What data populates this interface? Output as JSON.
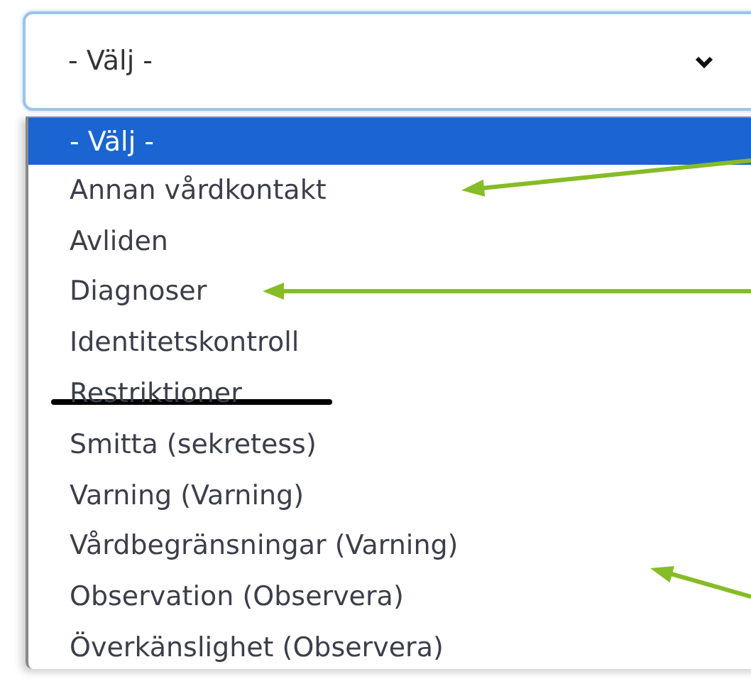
{
  "select": {
    "value": "- Välj -",
    "expanded": true
  },
  "options": [
    {
      "label": "- Välj -",
      "selected": true
    },
    {
      "label": "Annan vårdkontakt",
      "selected": false
    },
    {
      "label": "Avliden",
      "selected": false
    },
    {
      "label": "Diagnoser",
      "selected": false
    },
    {
      "label": "Identitetskontroll",
      "selected": false
    },
    {
      "label": "Restriktioner",
      "selected": false,
      "struck": true
    },
    {
      "label": "Smitta (sekretess)",
      "selected": false
    },
    {
      "label": "Varning (Varning)",
      "selected": false
    },
    {
      "label": "Vårdbegränsningar (Varning)",
      "selected": false
    },
    {
      "label": "Observation (Observera)",
      "selected": false
    },
    {
      "label": "Överkänslighet (Observera)",
      "selected": false
    }
  ]
}
